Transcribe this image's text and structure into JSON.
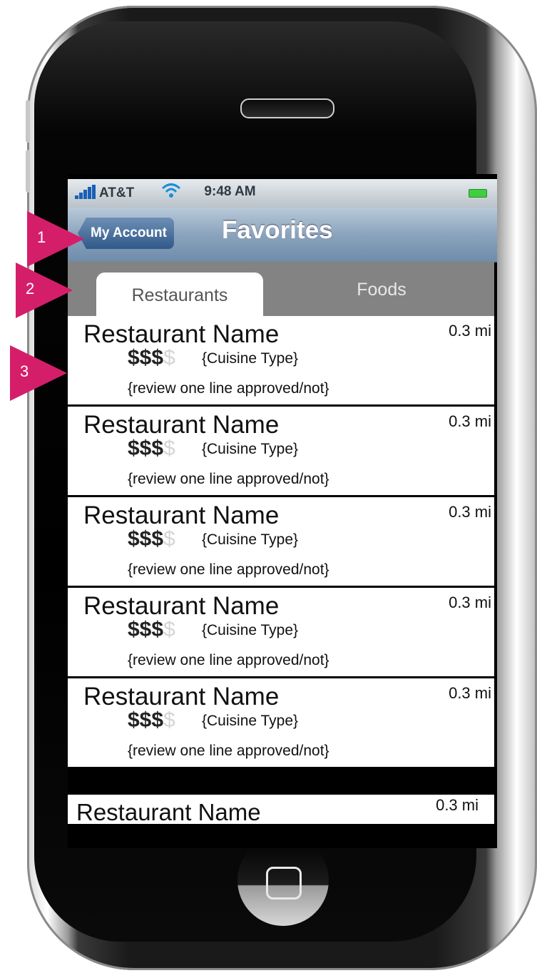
{
  "status_bar": {
    "carrier": "AT&T",
    "time": "9:48 AM"
  },
  "nav": {
    "back_label": "My Account",
    "title": "Favorites"
  },
  "tabs": [
    {
      "label": "Restaurants",
      "active": true
    },
    {
      "label": "Foods",
      "active": false
    }
  ],
  "price": {
    "active": "$$$",
    "inactive": "$"
  },
  "restaurants": [
    {
      "name": "Restaurant Name",
      "distance": "0.3 mi",
      "cuisine": "{Cuisine Type}",
      "review": "{review one line approved/not}"
    },
    {
      "name": "Restaurant Name",
      "distance": "0.3 mi",
      "cuisine": "{Cuisine Type}",
      "review": "{review one line approved/not}"
    },
    {
      "name": "Restaurant Name",
      "distance": "0.3 mi",
      "cuisine": "{Cuisine Type}",
      "review": "{review one line approved/not}"
    },
    {
      "name": "Restaurant Name",
      "distance": "0.3 mi",
      "cuisine": "{Cuisine Type}",
      "review": "{review one line approved/not}"
    },
    {
      "name": "Restaurant Name",
      "distance": "0.3 mi",
      "cuisine": "{Cuisine Type}",
      "review": "{review one line approved/not}"
    },
    {
      "name": "Restaurant Name",
      "distance": "0.3 mi"
    }
  ],
  "annotations": [
    "1",
    "2",
    "3"
  ],
  "colors": {
    "annotation": "#d51e6a",
    "nav_bar": "#8ba3bd",
    "back_button": "#2f5989",
    "segment_bar": "#838383"
  }
}
